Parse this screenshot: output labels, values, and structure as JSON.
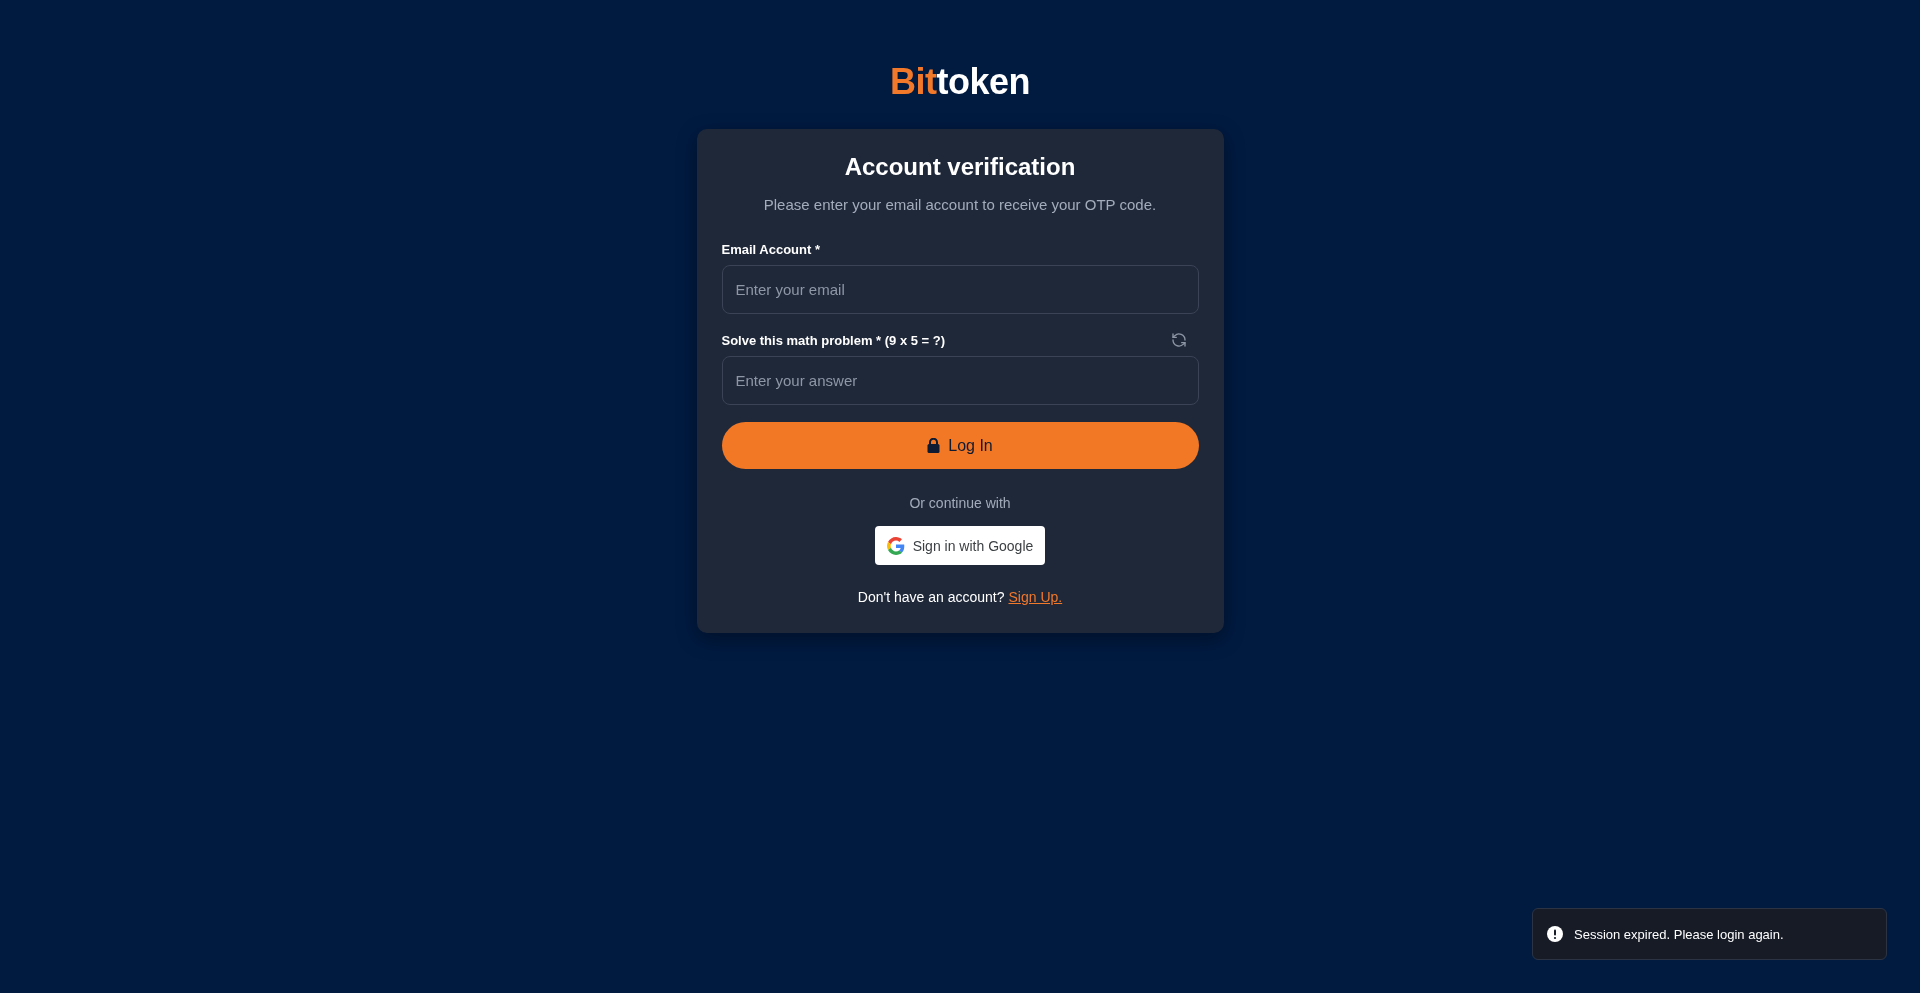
{
  "logo": {
    "accent": "Bit",
    "rest": "token"
  },
  "card": {
    "title": "Account verification",
    "subtitle": "Please enter your email account to receive your OTP code.",
    "fields": [
      {
        "kind": "text",
        "label": "Email Account *",
        "placeholder": "Enter your email"
      },
      {
        "kind": "captcha",
        "label": "Solve this math problem * (9 x 5 = ?)",
        "placeholder": "Enter your answer"
      }
    ],
    "submit": "Log In",
    "divider": "Or continue with",
    "google": "Sign in with Google",
    "signup": {
      "prompt": "Don't have an account?",
      "link": "Sign Up."
    }
  },
  "toast": {
    "message": "Session expired. Please login again."
  }
}
